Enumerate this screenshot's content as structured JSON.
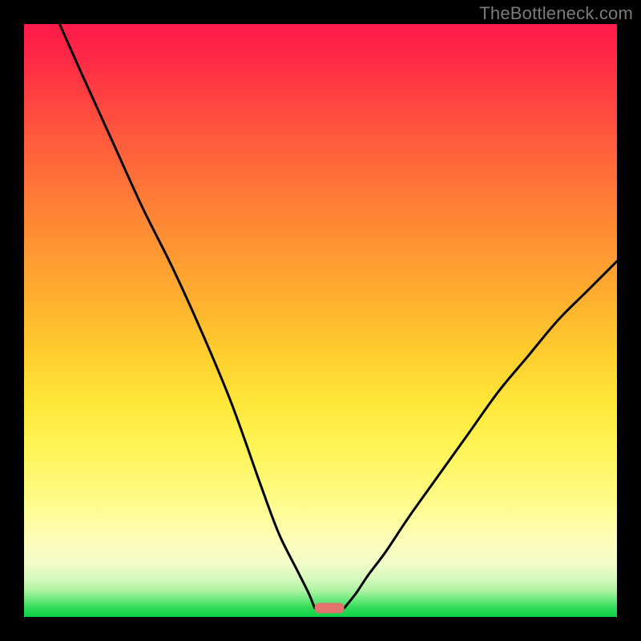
{
  "watermark": "TheBottleneck.com",
  "chart_data": {
    "type": "line",
    "title": "",
    "xlabel": "",
    "ylabel": "",
    "xlim": [
      0,
      100
    ],
    "ylim": [
      0,
      100
    ],
    "grid": false,
    "legend": "none",
    "description": "Bottleneck percentage curve on a red-yellow-green heat background. Two branches descend to a small flat minimum near the bottom; left branch starts near the top-left corner, right branch rises toward the mid-right edge. The pink pill marks the optimum (minimum bottleneck).",
    "optimum": {
      "x_range": [
        49,
        54
      ],
      "y": 1.5
    },
    "series": [
      {
        "name": "left-branch",
        "x": [
          6,
          10,
          15,
          20,
          25,
          30,
          35,
          40,
          43,
          46,
          48,
          49
        ],
        "y": [
          100,
          91,
          80,
          69,
          59,
          48,
          36,
          22,
          14,
          8,
          4,
          1.5
        ]
      },
      {
        "name": "right-branch",
        "x": [
          54,
          56,
          58,
          61,
          65,
          70,
          75,
          80,
          85,
          90,
          95,
          100
        ],
        "y": [
          1.5,
          4,
          7,
          11,
          17,
          24,
          31,
          38,
          44,
          50,
          55,
          60
        ]
      }
    ],
    "background_gradient_stops": [
      {
        "pos": 0.0,
        "color": "#ff1a4a"
      },
      {
        "pos": 0.24,
        "color": "#ff6a3a"
      },
      {
        "pos": 0.56,
        "color": "#ffcf2e"
      },
      {
        "pos": 0.8,
        "color": "#fffb86"
      },
      {
        "pos": 0.95,
        "color": "#aef3a2"
      },
      {
        "pos": 1.0,
        "color": "#0bd148"
      }
    ]
  }
}
